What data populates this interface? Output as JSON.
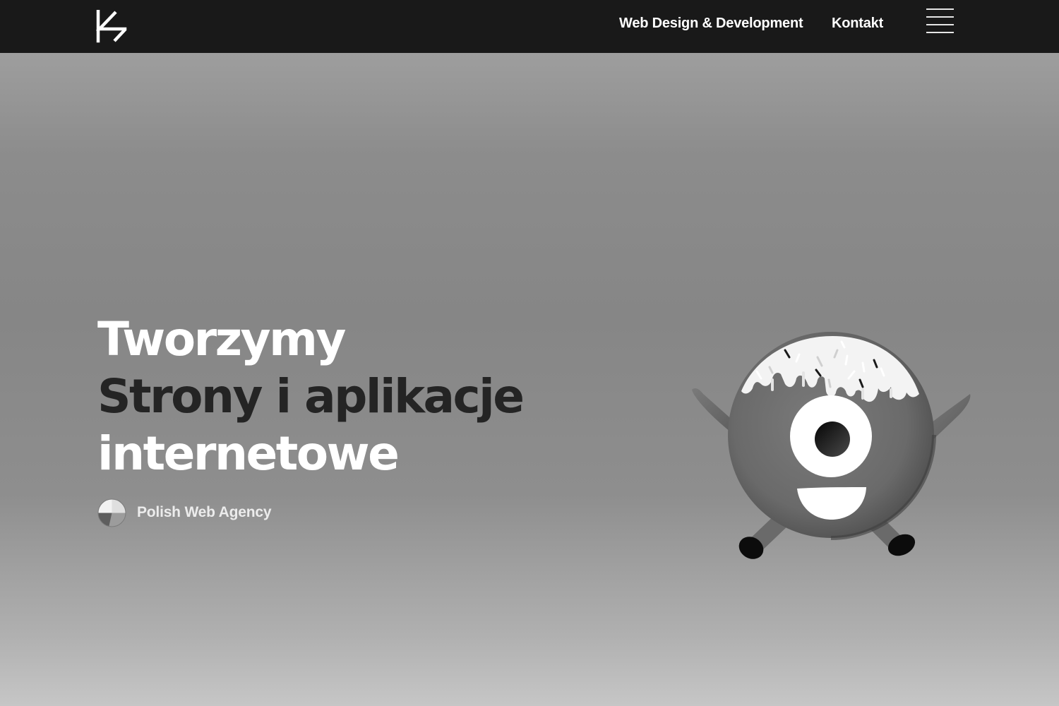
{
  "header": {
    "logo_letter": "K",
    "nav": [
      {
        "label": "Web Design & Development"
      },
      {
        "label": "Kontakt"
      }
    ],
    "menu_icon": "hamburger-menu-icon"
  },
  "hero": {
    "headline_line1": "Tworzymy",
    "headline_line2": "Strony i aplikacje",
    "headline_line3": "internetowe",
    "tagline": "Polish Web Agency",
    "tagline_icon": "polish-flag-circle-icon",
    "illustration": "donut-mascot-illustration"
  },
  "colors": {
    "header_bg": "#191919",
    "headline_light": "#ffffff",
    "headline_dark": "#242424",
    "tagline_text": "#ececec"
  }
}
